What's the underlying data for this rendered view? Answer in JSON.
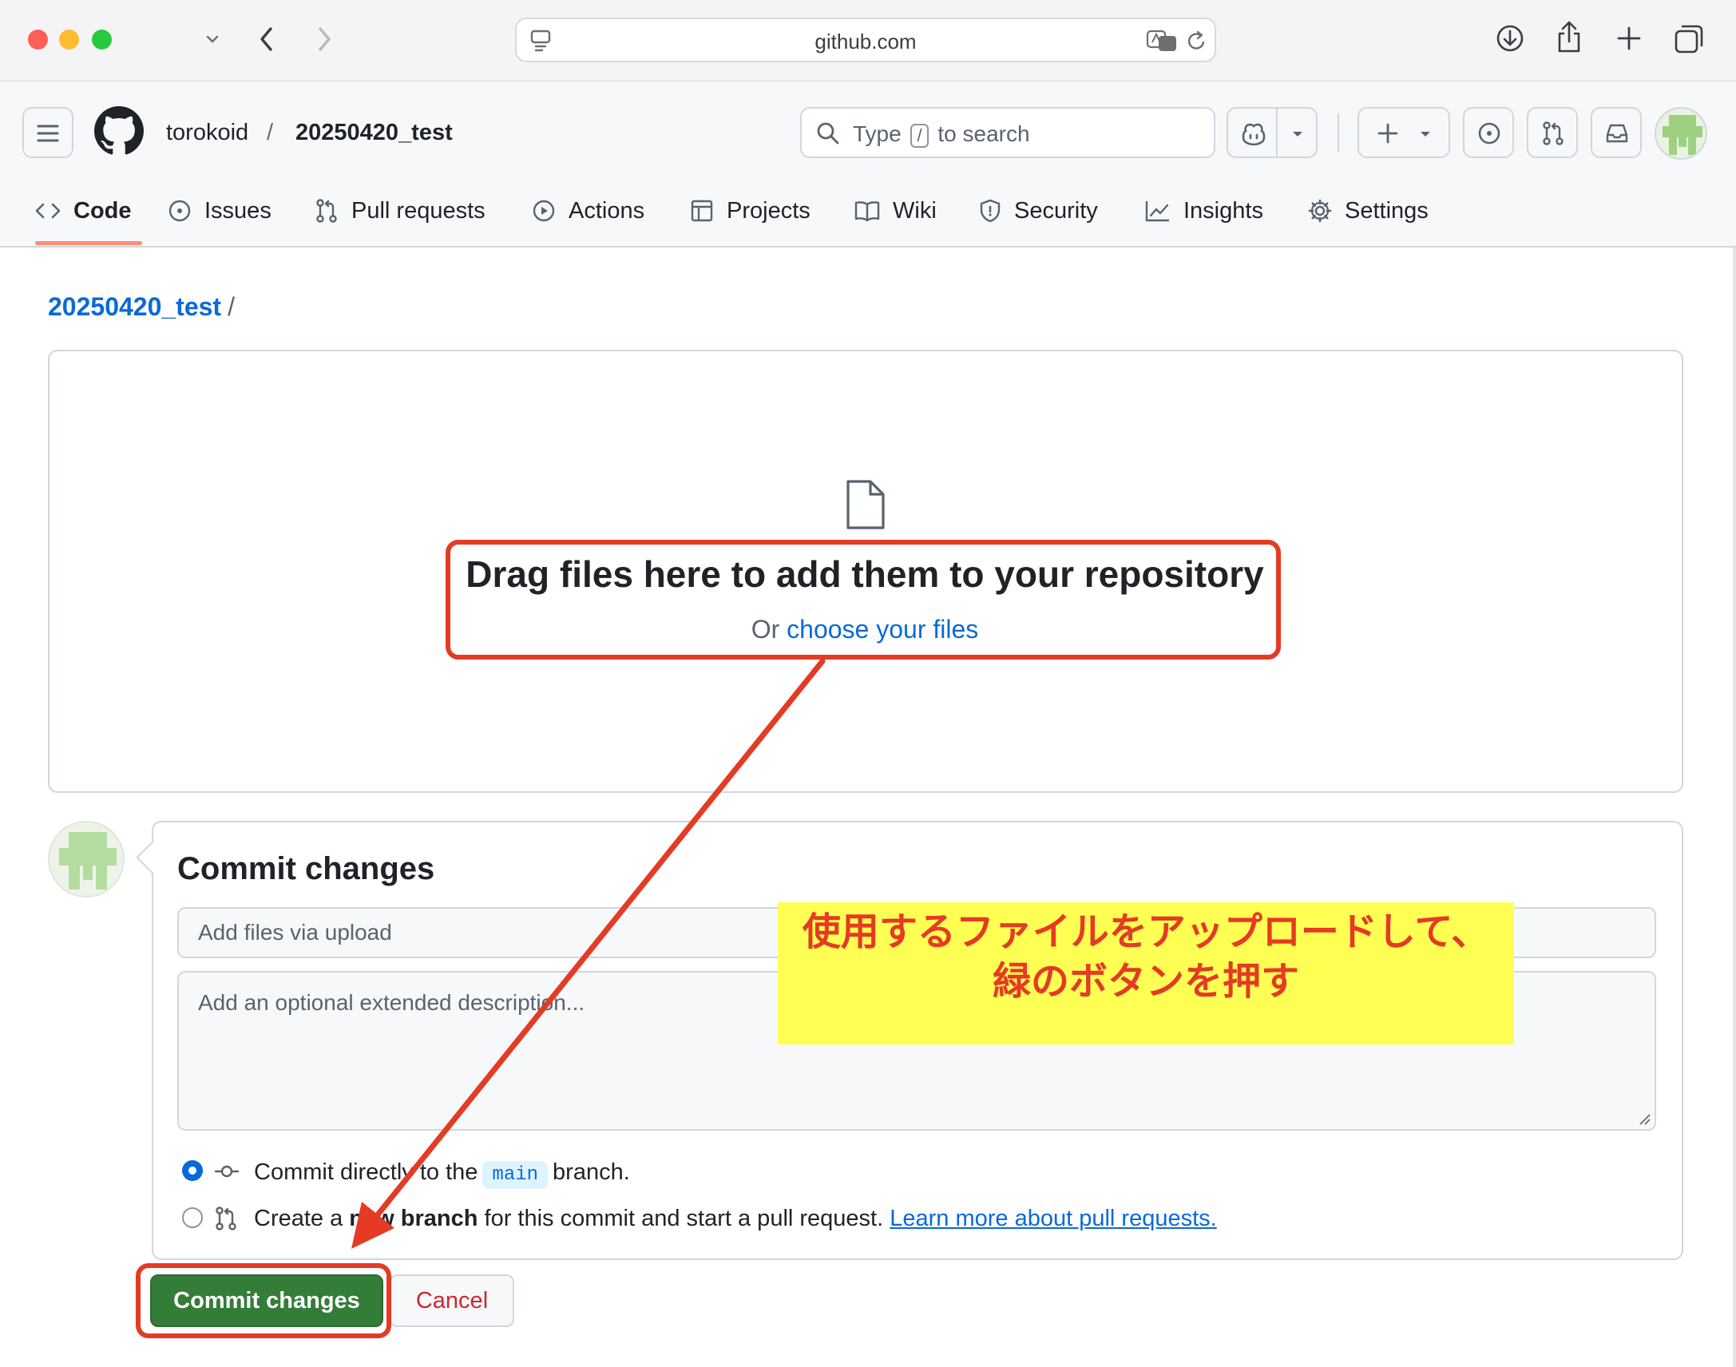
{
  "browser": {
    "url": "github.com"
  },
  "header": {
    "owner": "torokoid",
    "separator": "/",
    "repo": "20250420_test",
    "search_prefix": "Type",
    "search_key": "/",
    "search_suffix": "to search"
  },
  "tabs": [
    {
      "label": "Code"
    },
    {
      "label": "Issues"
    },
    {
      "label": "Pull requests"
    },
    {
      "label": "Actions"
    },
    {
      "label": "Projects"
    },
    {
      "label": "Wiki"
    },
    {
      "label": "Security"
    },
    {
      "label": "Insights"
    },
    {
      "label": "Settings"
    }
  ],
  "breadcrumb": {
    "repo": "20250420_test",
    "separator": "/"
  },
  "dropzone": {
    "title": "Drag files here to add them to your repository",
    "or": "Or",
    "choose_link": "choose your files"
  },
  "commit": {
    "title": "Commit changes",
    "summary_placeholder": "Add files via upload",
    "description_placeholder": "Add an optional extended description...",
    "option_direct_prefix": "Commit directly to the",
    "option_direct_branch": "main",
    "option_direct_suffix": "branch.",
    "option_new_prefix": "Create a",
    "option_new_bold": "new branch",
    "option_new_suffix": "for this commit and start a pull request.",
    "learn_more": "Learn more about pull requests.",
    "submit_label": "Commit changes",
    "cancel_label": "Cancel",
    "selected_option": "direct"
  },
  "annotation": {
    "line1": "使用するファイルをアップロードして、",
    "line2": "緑のボタンを押す",
    "highlight_color": "#ffff54",
    "accent_color": "#e53a24"
  },
  "icons": [
    "sidebar-icon",
    "chevron-down-icon",
    "back-icon",
    "forward-icon",
    "page-icon",
    "translate-icon",
    "reload-icon",
    "download-icon",
    "share-icon",
    "new-tab-icon",
    "tabs-overview-icon",
    "hamburger-icon",
    "github-logo-icon",
    "search-icon",
    "copilot-icon",
    "plus-icon",
    "issue-icon",
    "pull-request-icon",
    "inbox-icon",
    "code-icon",
    "actions-icon",
    "table-icon",
    "book-icon",
    "shield-icon",
    "graph-icon",
    "gear-icon",
    "file-icon",
    "commit-icon"
  ],
  "colors": {
    "link": "#0969da",
    "primary_button": "#347d39",
    "tab_underline": "#fd8c73",
    "danger": "#d1242f"
  }
}
